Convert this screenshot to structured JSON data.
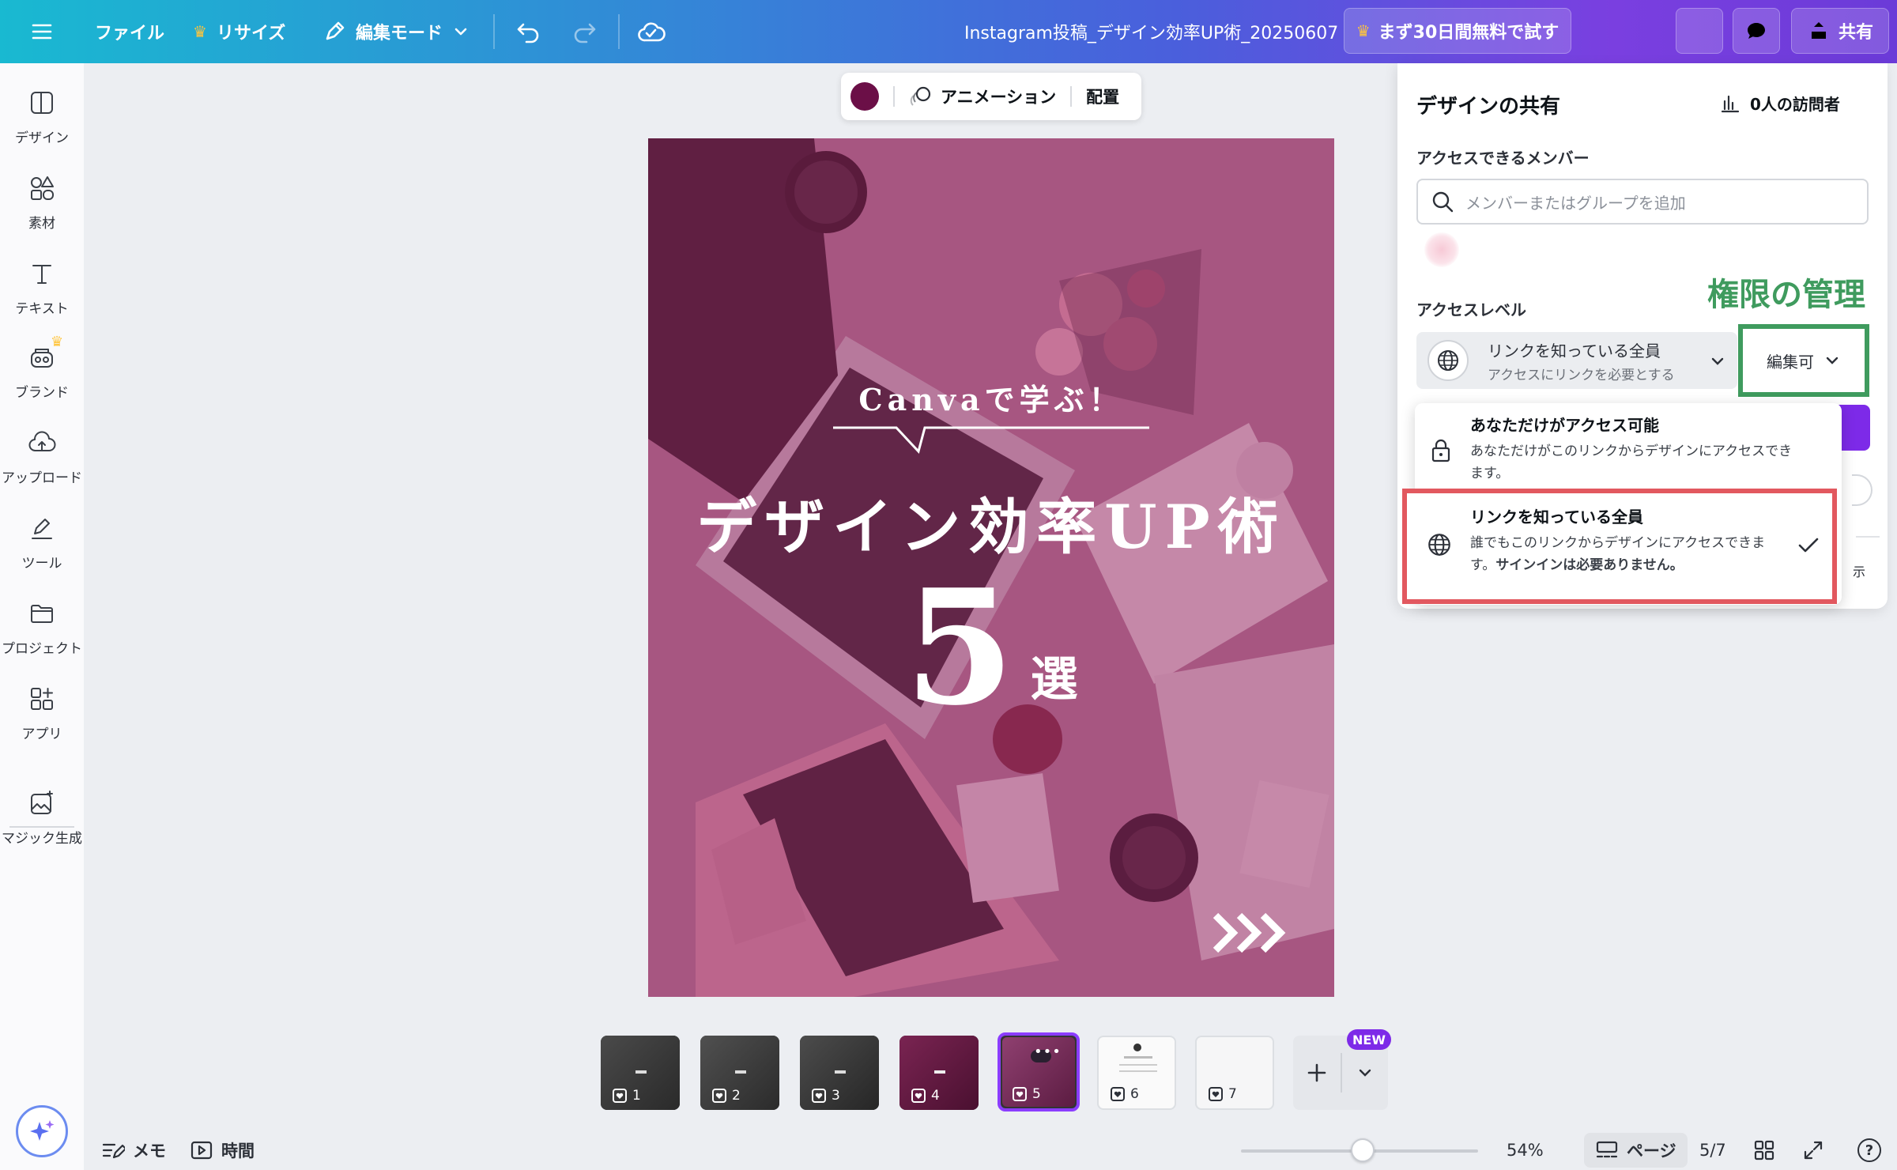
{
  "colors": {
    "accent": "#7d2ae8",
    "annotation_green": "#3f9b5e",
    "annotation_red": "#e2585f",
    "design_color": "#6b0f47"
  },
  "topbar": {
    "menu_icon": "hamburger-icon",
    "file": "ファイル",
    "resize": "リサイズ",
    "edit_mode": "編集モード",
    "document_title": "Instagram投稿_デザイン効率UP術_20250607",
    "trial": "まず30日間無料で試す",
    "share": "共有"
  },
  "sidebar": {
    "items": [
      {
        "label": "デザイン",
        "icon": "layout-icon"
      },
      {
        "label": "素材",
        "icon": "elements-icon"
      },
      {
        "label": "テキスト",
        "icon": "text-icon"
      },
      {
        "label": "ブランド",
        "icon": "brand-icon"
      },
      {
        "label": "アップロード",
        "icon": "upload-cloud-icon"
      },
      {
        "label": "ツール",
        "icon": "draw-tool-icon"
      },
      {
        "label": "プロジェクト",
        "icon": "folder-icon"
      },
      {
        "label": "アプリ",
        "icon": "apps-icon"
      },
      {
        "label": "マジック生成",
        "icon": "magic-image-icon"
      }
    ]
  },
  "floating_toolbar": {
    "animation": "アニメーション",
    "position": "配置"
  },
  "design": {
    "subtitle": "Canvaで学ぶ！",
    "headline": "デザイン効率UP術",
    "number": "5",
    "suffix": "選",
    "arrows": ">>>"
  },
  "share_panel": {
    "title": "デザインの共有",
    "visitors": "0人の訪問者",
    "members_label": "アクセスできるメンバー",
    "search_placeholder": "メンバーまたはグループを追加",
    "access_level_label": "アクセスレベル",
    "access_value_title": "リンクを知っている全員",
    "access_value_sub": "アクセスにリンクを必要とする",
    "permission": "編集可",
    "menu": [
      {
        "title": "あなただけがアクセス可能",
        "desc_1": "あなただけがこのリンクからデザインにアクセスでき",
        "desc_2": "ます。",
        "selected": false
      },
      {
        "title": "リンクを知っている全員",
        "desc_1": "誰でもこのリンクからデザインにアクセスできま",
        "desc_2_a": "す。",
        "desc_2_b": "サインインは必要ありません。",
        "selected": true
      }
    ],
    "clipped_text": "示"
  },
  "annotation_label": "権限の管理",
  "pages": {
    "labels": [
      "1",
      "2",
      "3",
      "4",
      "5",
      "6",
      "7"
    ],
    "current": 5,
    "new_badge": "NEW"
  },
  "bottombar": {
    "notes": "メモ",
    "timer": "時間",
    "zoom": "54%",
    "zoom_level": 0.54,
    "pages_label": "ページ",
    "page_count": "5/7",
    "help": "?"
  }
}
